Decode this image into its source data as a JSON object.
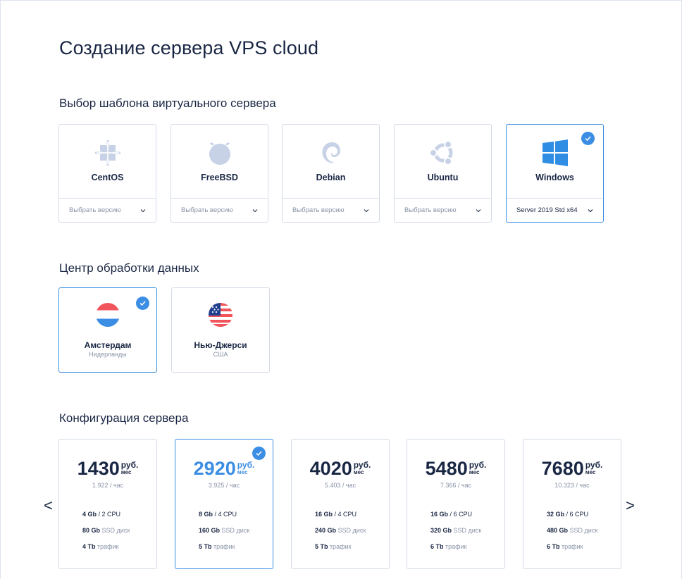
{
  "page_title": "Создание сервера VPS cloud",
  "sections": {
    "template": "Выбор шаблона виртуального сервера",
    "datacenter": "Центр обработки данных",
    "config": "Конфигурация сервера"
  },
  "os_templates": [
    {
      "name": "CentOS",
      "version": "Выбрать версию",
      "icon": "centos-icon",
      "selected": false
    },
    {
      "name": "FreeBSD",
      "version": "Выбрать версию",
      "icon": "freebsd-icon",
      "selected": false
    },
    {
      "name": "Debian",
      "version": "Выбрать версию",
      "icon": "debian-icon",
      "selected": false
    },
    {
      "name": "Ubuntu",
      "version": "Выбрать версию",
      "icon": "ubuntu-icon",
      "selected": false
    },
    {
      "name": "Windows",
      "version": "Server 2019 Std x64",
      "icon": "windows-icon",
      "selected": true
    }
  ],
  "datacenters": [
    {
      "city": "Амстердам",
      "country": "Нидерланды",
      "icon": "netherlands-flag-icon",
      "selected": true
    },
    {
      "city": "Нью-Джерси",
      "country": "США",
      "icon": "usa-flag-icon",
      "selected": false
    }
  ],
  "plans": [
    {
      "price": "1430",
      "currency": "руб.",
      "period": "мес",
      "hourly": "1.922 / час",
      "ram": "4 Gb",
      "cpu": "/ 2 CPU",
      "disk": "80 Gb",
      "disk_label": "SSD диск",
      "traffic": "4 Tb",
      "traffic_label": "трафик",
      "selected": false
    },
    {
      "price": "2920",
      "currency": "руб.",
      "period": "мес",
      "hourly": "3.925 / час",
      "ram": "8 Gb",
      "cpu": "/ 4 CPU",
      "disk": "160 Gb",
      "disk_label": "SSD диск",
      "traffic": "5 Tb",
      "traffic_label": "трафик",
      "selected": true
    },
    {
      "price": "4020",
      "currency": "руб.",
      "period": "мес",
      "hourly": "5.403 / час",
      "ram": "16 Gb",
      "cpu": "/ 4 CPU",
      "disk": "240 Gb",
      "disk_label": "SSD диск",
      "traffic": "5 Tb",
      "traffic_label": "трафик",
      "selected": false
    },
    {
      "price": "5480",
      "currency": "руб.",
      "period": "мес",
      "hourly": "7.366 / час",
      "ram": "16 Gb",
      "cpu": "/ 6 CPU",
      "disk": "320 Gb",
      "disk_label": "SSD диск",
      "traffic": "6 Tb",
      "traffic_label": "трафик",
      "selected": false
    },
    {
      "price": "7680",
      "currency": "руб.",
      "period": "мес",
      "hourly": "10.323 / час",
      "ram": "32 Gb",
      "cpu": "/ 6 CPU",
      "disk": "480 Gb",
      "disk_label": "SSD диск",
      "traffic": "6 Tb",
      "traffic_label": "трафик",
      "selected": false
    }
  ],
  "nav": {
    "prev": "<",
    "next": ">"
  },
  "colors": {
    "accent": "#3b8ee3",
    "text": "#1a2744",
    "muted": "#8892a6",
    "icon_gray": "#c7d2e6",
    "border": "#d4dbe7"
  }
}
